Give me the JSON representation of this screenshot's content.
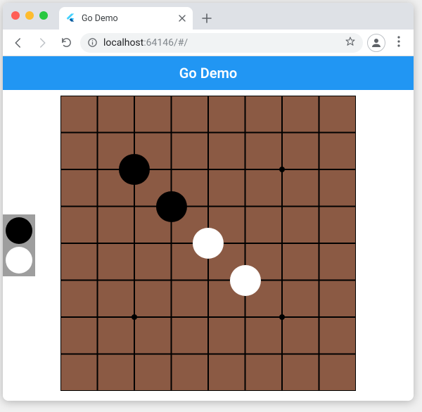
{
  "browser": {
    "tab_title": "Go Demo",
    "url_host": "localhost",
    "url_rest": ":64146/#/"
  },
  "app": {
    "title": "Go Demo"
  },
  "board": {
    "size": 9,
    "star_points": [
      [
        2,
        2
      ],
      [
        6,
        2
      ],
      [
        2,
        6
      ],
      [
        6,
        6
      ]
    ],
    "stones": [
      {
        "col": 2,
        "row": 2,
        "color": "black"
      },
      {
        "col": 3,
        "row": 3,
        "color": "black"
      },
      {
        "col": 4,
        "row": 4,
        "color": "white"
      },
      {
        "col": 5,
        "row": 5,
        "color": "white"
      }
    ]
  },
  "palette": {
    "colors": [
      "black",
      "white"
    ]
  }
}
